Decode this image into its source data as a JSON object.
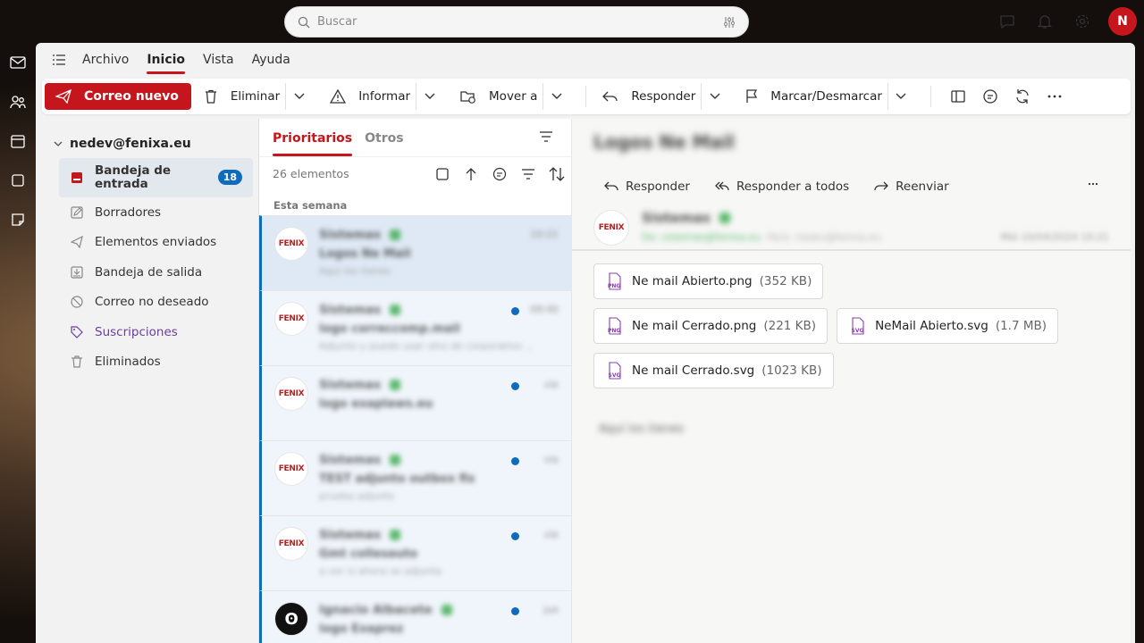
{
  "search": {
    "placeholder": "Buscar"
  },
  "user": {
    "initial": "N"
  },
  "menu": {
    "items": [
      "Archivo",
      "Inicio",
      "Vista",
      "Ayuda"
    ],
    "active": "Inicio"
  },
  "ribbon": {
    "new_mail": "Correo nuevo",
    "delete": "Eliminar",
    "report": "Informar",
    "move": "Mover a",
    "reply": "Responder",
    "flag": "Marcar/Desmarcar"
  },
  "account": {
    "email": "nedev@fenixa.eu"
  },
  "folders": [
    {
      "label": "Bandeja de entrada",
      "count": "18",
      "icon": "inbox-icon"
    },
    {
      "label": "Borradores",
      "icon": "pencil-icon"
    },
    {
      "label": "Elementos enviados",
      "icon": "send-icon"
    },
    {
      "label": "Bandeja de salida",
      "icon": "outbox-icon"
    },
    {
      "label": "Correo no deseado",
      "icon": "blocked-icon"
    },
    {
      "label": "Suscripciones",
      "icon": "tag-icon"
    },
    {
      "label": "Eliminados",
      "icon": "trash-icon"
    }
  ],
  "list": {
    "tabs": [
      "Prioritarios",
      "Otros"
    ],
    "count": "26 elementos",
    "group": "Esta semana",
    "messages": [
      {
        "avatar": "FENIX",
        "from": "Sistemas",
        "subject": "Logos Ne Mail",
        "preview": "Aquí los tienes",
        "time": "10:21",
        "unread": false,
        "selected": true
      },
      {
        "avatar": "FENIX",
        "from": "Sistemas",
        "subject": "logo correccomp.mail",
        "preview": "Adjunto y puedo usar otro de corporativo ...",
        "time": "09:40",
        "unread": true,
        "selected": false
      },
      {
        "avatar": "FENIX",
        "from": "Sistemas",
        "subject": "logo exaplaws.eu",
        "preview": "",
        "time": "vie",
        "unread": true,
        "selected": false
      },
      {
        "avatar": "FENIX",
        "from": "Sistemas",
        "subject": "TEST adjunto outbox fix",
        "preview": "prueba adjunto",
        "time": "vie",
        "unread": true,
        "selected": false
      },
      {
        "avatar": "FENIX",
        "from": "Sistemas",
        "subject": "Gmt collesauto",
        "preview": "a ver si ahora se adjunta",
        "time": "vie",
        "unread": true,
        "selected": false
      },
      {
        "avatar": "ʘ",
        "from": "Ignacio Albacete",
        "subject": "logo Exaprez",
        "preview": "",
        "time": "jue",
        "unread": true,
        "selected": false
      }
    ]
  },
  "reader": {
    "subject": "Logos Ne Mail",
    "actions": {
      "reply": "Responder",
      "reply_all": "Responder a todos",
      "forward": "Reenviar"
    },
    "from": "Sistemas",
    "to": "De: sistemas@fenixa.eu",
    "cc": "Para: nedev@fenixa.eu",
    "date": "Mié 10/04/2024 10:21",
    "attachments": [
      {
        "name": "Ne mail Abierto.png",
        "size": "(352 KB)",
        "type": "PNG"
      },
      {
        "name": "Ne mail Cerrado.png",
        "size": "(221 KB)",
        "type": "PNG"
      },
      {
        "name": "NeMail Abierto.svg",
        "size": "(1.7 MB)",
        "type": "SVG"
      },
      {
        "name": "Ne mail Cerrado.svg",
        "size": "(1023 KB)",
        "type": "SVG"
      }
    ],
    "signature": "Aquí los tienes"
  },
  "colors": {
    "brand": "#c4161c",
    "accent": "#0f6cbd",
    "badge_green": "#2ba640"
  }
}
